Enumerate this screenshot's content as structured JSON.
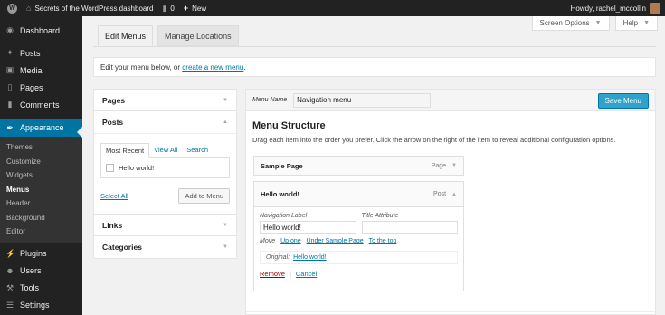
{
  "adminbar": {
    "site_title": "Secrets of the WordPress dashboard",
    "comments_count": "0",
    "new_label": "New",
    "greeting": "Howdy, rachel_mccollin"
  },
  "sidebar": {
    "dashboard": "Dashboard",
    "posts": "Posts",
    "media": "Media",
    "pages": "Pages",
    "comments": "Comments",
    "appearance": "Appearance",
    "submenu": [
      "Themes",
      "Customize",
      "Widgets",
      "Menus",
      "Header",
      "Background",
      "Editor"
    ],
    "plugins": "Plugins",
    "users": "Users",
    "tools": "Tools",
    "settings": "Settings"
  },
  "screen_meta": {
    "screen_options": "Screen Options",
    "help": "Help"
  },
  "tabs": {
    "edit_menus": "Edit Menus",
    "manage_locations": "Manage Locations"
  },
  "manage": {
    "prefix": "Edit your menu below, or ",
    "link": "create a new menu",
    "suffix": "."
  },
  "accordion": {
    "pages": "Pages",
    "posts": "Posts",
    "links": "Links",
    "categories": "Categories",
    "subtabs": [
      "Most Recent",
      "View All",
      "Search"
    ],
    "post_item": "Hello world!",
    "select_all": "Select All",
    "add_to_menu": "Add to Menu"
  },
  "menu_editor": {
    "menu_name_label": "Menu Name",
    "menu_name_value": "Navigation menu",
    "save_label": "Save Menu",
    "structure_title": "Menu Structure",
    "structure_help": "Drag each item into the order you prefer. Click the arrow on the right of the item to reveal additional configuration options.",
    "items": [
      {
        "title": "Sample Page",
        "type": "Page"
      },
      {
        "title": "Hello world!",
        "type": "Post"
      }
    ],
    "settings": {
      "nav_label_label": "Navigation Label",
      "nav_label_value": "Hello world!",
      "title_attr_label": "Title Attribute",
      "title_attr_value": "",
      "move_label": "Move",
      "move_up": "Up one",
      "move_under": "Under Sample Page",
      "move_top": "To the top",
      "original_label": "Original:",
      "original_link": "Hello world!",
      "remove": "Remove",
      "separator": "|",
      "cancel": "Cancel"
    }
  }
}
